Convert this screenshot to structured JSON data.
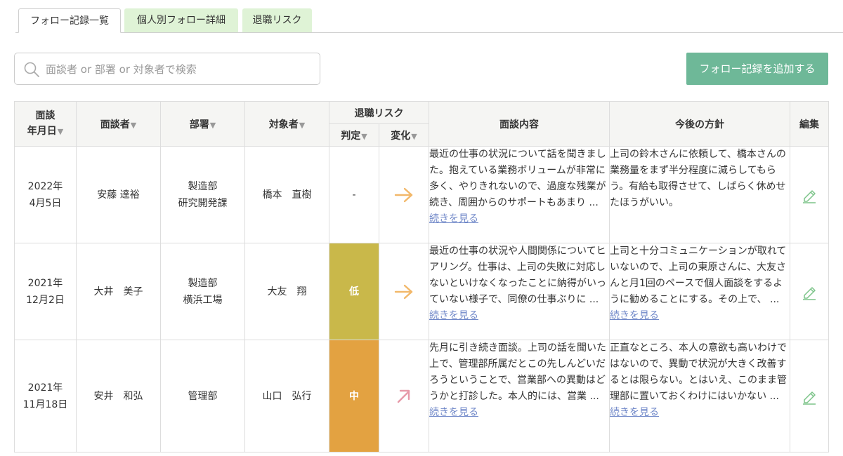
{
  "tabs": [
    {
      "label": "フォロー記録一覧",
      "active": true
    },
    {
      "label": "個人別フォロー詳細",
      "active": false
    },
    {
      "label": "退職リスク",
      "active": false
    }
  ],
  "search": {
    "placeholder": "面談者 or 部署 or 対象者で検索",
    "value": "",
    "icon": "search-icon"
  },
  "add_button": {
    "label": "フォロー記録を追加する"
  },
  "colors": {
    "accent": "#6eb898",
    "tab_inactive": "#dff3d6",
    "risk_low": "#c9b84a",
    "risk_mid": "#e3a241",
    "arrow_flat": "#f2b86a",
    "arrow_up": "#e79aa9",
    "edit_icon": "#7cc489",
    "link": "#6f87c8"
  },
  "table": {
    "headers": {
      "date_line1": "面談",
      "date_line2": "年月日",
      "interviewer": "面談者",
      "department": "部署",
      "target": "対象者",
      "risk_group": "退職リスク",
      "risk_judgement": "判定",
      "risk_change": "変化",
      "content": "面談内容",
      "policy": "今後の方針",
      "edit": "編集",
      "sort_mark": "▼"
    },
    "rows": [
      {
        "date_line1": "2022年",
        "date_line2": "4月5日",
        "interviewer": "安藤 達裕",
        "department_line1": "製造部",
        "department_line2": "研究開発課",
        "target": "橋本　直樹",
        "risk": "-",
        "change": "flat-arrow-icon",
        "content": "最近の仕事の状況について話を聞きました。抱えている業務ボリュームが非常に多く、やりきれないので、過度な残業が続き、周囲からのサポートもあまり ...",
        "content_more": "続きを見る",
        "policy": "上司の鈴木さんに依頼して、橋本さんの業務量をまず半分程度に減らしてもらう。有給も取得させて、しばらく休めせたほうがいい。",
        "policy_more": ""
      },
      {
        "date_line1": "2021年",
        "date_line2": "12月2日",
        "interviewer": "大井　美子",
        "department_line1": "製造部",
        "department_line2": "横浜工場",
        "target": "大友　翔",
        "risk": "低",
        "change": "flat-arrow-icon",
        "content": "最近の仕事の状況や人間関係についてヒアリング。仕事は、上司の失敗に対応しないといけなくなったことに納得がいっていない様子で、同僚の仕事ぶりに ...",
        "content_more": "続きを見る",
        "policy": "上司と十分コミュニケーションが取れていないので、上司の東原さんに、大友さんと月1回のペースで個人面談をするように勧めることにする。その上で、 ...",
        "policy_more": "続きを見る"
      },
      {
        "date_line1": "2021年",
        "date_line2": "11月18日",
        "interviewer": "安井　和弘",
        "department_line1": "管理部",
        "department_line2": "",
        "target": "山口　弘行",
        "risk": "中",
        "change": "up-right-arrow-icon",
        "content": "先月に引き続き面談。上司の話を聞いた上で、管理部所属だとこの先しんどいだろうということで、営業部への異動はどうかと打診した。本人的には、営業 ...",
        "content_more": "続きを見る",
        "policy": "正直なところ、本人の意欲も高いわけではないので、異動で状況が大きく改善するとは限らない。とはいえ、このまま管理部に置いておくわけにはいかない ...",
        "policy_more": "続きを見る"
      }
    ]
  }
}
